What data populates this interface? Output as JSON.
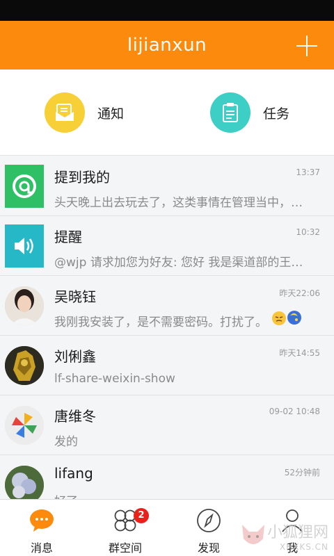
{
  "header": {
    "title": "lijianxun",
    "add_icon": "plus-icon"
  },
  "quick": [
    {
      "label": "通知",
      "icon": "mail-icon",
      "color": "#f7cf37"
    },
    {
      "label": "任务",
      "icon": "clipboard-icon",
      "color": "#3dcfc6"
    }
  ],
  "chats": [
    {
      "name": "提到我的",
      "time": "13:37",
      "msg": "头天晚上出去玩去了，这类事情在管理当中，…",
      "avatar": "mention-icon"
    },
    {
      "name": "提醒",
      "time": "10:32",
      "msg": "@wjp 请求加您为好友: 您好 我是渠道部的王继…",
      "avatar": "speaker-icon"
    },
    {
      "name": "吴晓钰",
      "time": "昨天22:06",
      "msg": "我刚我安装了，是不需要密码。打扰了。",
      "avatar": "user-photo"
    },
    {
      "name": "刘俐鑫",
      "time": "昨天14:55",
      "msg": "lf-share-weixin-show",
      "avatar": "user-photo"
    },
    {
      "name": "唐维冬",
      "time": "09-02 10:48",
      "msg": "发的",
      "avatar": "pinwheel-icon"
    },
    {
      "name": "lifang",
      "time": "52分钟前",
      "msg": "好了",
      "avatar": "flower-photo"
    }
  ],
  "tabs": [
    {
      "label": "消息",
      "icon": "chat-bubble-icon"
    },
    {
      "label": "群空间",
      "icon": "clover-icon",
      "badge": "2"
    },
    {
      "label": "发现",
      "icon": "compass-icon"
    },
    {
      "label": "我",
      "icon": "person-icon"
    }
  ],
  "watermark": {
    "text": "小狐狸网",
    "sub": "XHXKS.CN"
  },
  "colors": {
    "header": "#fb8a0d",
    "active_tab": "#fb8a0d",
    "badge": "#e8221b"
  }
}
